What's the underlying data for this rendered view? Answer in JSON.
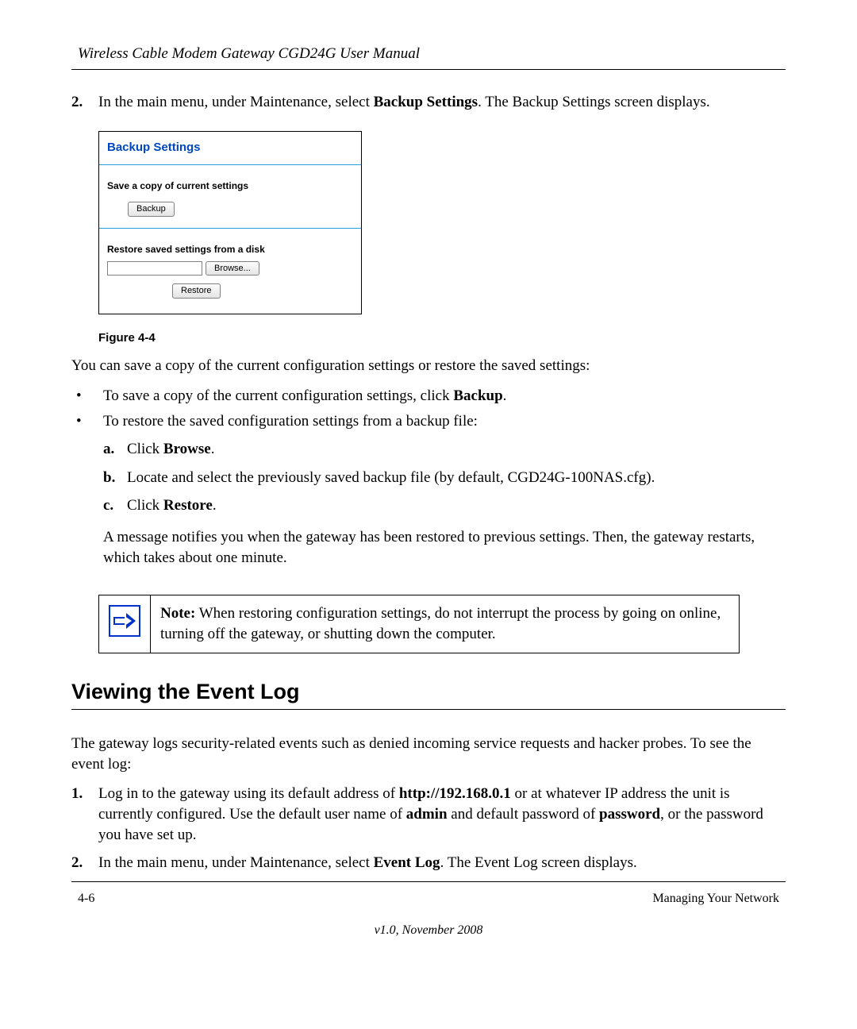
{
  "header": {
    "title": "Wireless Cable Modem Gateway CGD24G User Manual"
  },
  "step2": {
    "marker": "2.",
    "pre": "In the main menu, under Maintenance, select ",
    "bold": "Backup Settings",
    "post": ". The Backup Settings screen displays."
  },
  "screenshot": {
    "title": "Backup Settings",
    "save_label": "Save a copy of current settings",
    "backup_btn": "Backup",
    "restore_label": "Restore saved settings from a disk",
    "browse_btn": "Browse...",
    "restore_btn": "Restore"
  },
  "fig_caption": "Figure 4-4",
  "intro_line": "You can save a copy of the current configuration settings or restore the saved settings:",
  "bullet1": {
    "pre": "To save a copy of the current configuration settings, click ",
    "bold": "Backup",
    "post": "."
  },
  "bullet2": {
    "text": "To restore the saved configuration settings from a backup file:",
    "a": {
      "marker": "a.",
      "pre": "Click ",
      "bold": "Browse",
      "post": "."
    },
    "b": {
      "marker": "b.",
      "text": "Locate and select the previously saved backup file (by default, CGD24G-100NAS.cfg)."
    },
    "c": {
      "marker": "c.",
      "pre": "Click ",
      "bold": "Restore",
      "post": "."
    },
    "after": "A message notifies you when the gateway has been restored to previous settings. Then, the gateway restarts, which takes about one minute."
  },
  "note": {
    "label": "Note:",
    "text": " When restoring configuration settings, do not interrupt the process by going on online, turning off the gateway, or shutting down the computer."
  },
  "section_heading": "Viewing the Event Log",
  "section_intro": "The gateway logs security-related events such as denied incoming service requests and hacker probes. To see the event log:",
  "evt_step1": {
    "marker": "1.",
    "p1": "Log in to the gateway using its default address of ",
    "b1": "http://192.168.0.1",
    "p2": " or at whatever IP address the unit is currently configured. Use the default user name of ",
    "b2": "admin",
    "p3": " and default password of ",
    "b3": "password",
    "p4": ", or the password you have set up."
  },
  "evt_step2": {
    "marker": "2.",
    "pre": "In the main menu, under Maintenance, select ",
    "bold": "Event Log",
    "post": ". The Event Log screen displays."
  },
  "footer": {
    "page": "4-6",
    "chapter": "Managing Your Network",
    "version": "v1.0, November 2008"
  }
}
